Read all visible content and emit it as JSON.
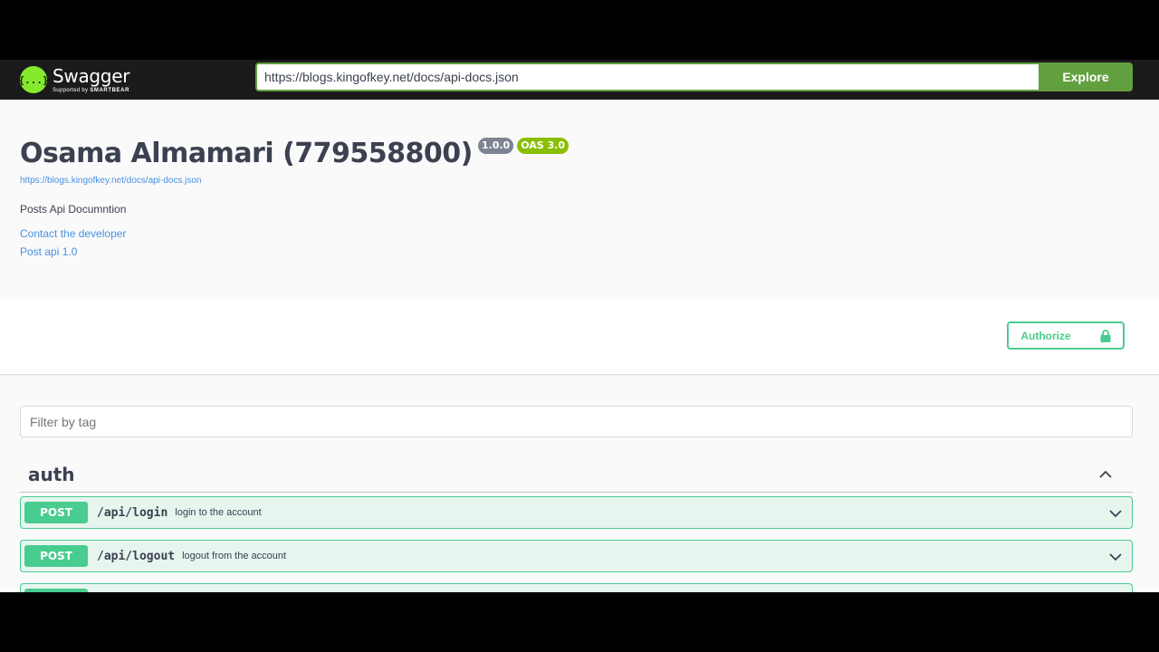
{
  "topbar": {
    "logo_name": "Swagger",
    "logo_sub_prefix": "Supported by",
    "logo_sub_brand": "SMARTBEAR",
    "logo_glyph": "{...}",
    "url_value": "https://blogs.kingofkey.net/docs/api-docs.json",
    "explore_label": "Explore"
  },
  "info": {
    "title": "Osama Almamari (779558800)",
    "version_badge": "1.0.0",
    "oas_badge": "OAS 3.0",
    "spec_url": "https://blogs.kingofkey.net/docs/api-docs.json",
    "description": "Posts Api Documntion",
    "contact_link": "Contact the developer",
    "license_link": "Post api 1.0"
  },
  "auth": {
    "authorize_label": "Authorize"
  },
  "filter": {
    "placeholder": "Filter by tag"
  },
  "tag": {
    "name": "auth",
    "operations": [
      {
        "method": "POST",
        "path": "/api/login",
        "summary": "login to the account"
      },
      {
        "method": "POST",
        "path": "/api/logout",
        "summary": "logout from the account"
      }
    ]
  },
  "colors": {
    "post_green": "#49cc90",
    "explore_green": "#62a03f",
    "link_blue": "#4990e2",
    "topbar_bg": "#1b1b1b"
  },
  "icons": [
    "swagger-logo-icon",
    "lock-icon",
    "chevron-up-icon",
    "chevron-down-icon"
  ]
}
